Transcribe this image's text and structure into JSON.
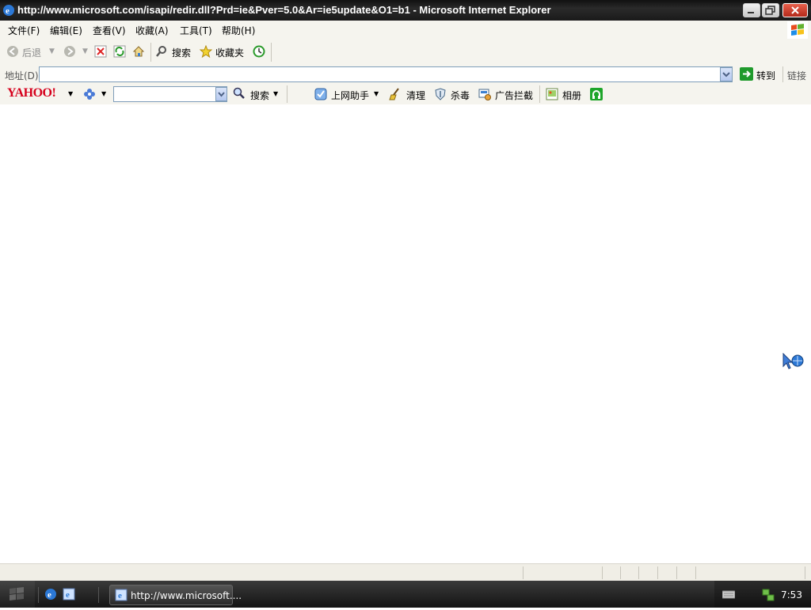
{
  "window": {
    "title": "http://www.microsoft.com/isapi/redir.dll?Prd=ie&Pver=5.0&Ar=ie5update&O1=b1 - Microsoft Internet Explorer"
  },
  "menu": {
    "items": [
      {
        "label": "文件(F)"
      },
      {
        "label": "编辑(E)"
      },
      {
        "label": "查看(V)"
      },
      {
        "label": "收藏(A)"
      },
      {
        "label": "工具(T)"
      },
      {
        "label": "帮助(H)"
      }
    ]
  },
  "toolbar": {
    "back_label": "后退",
    "search_label": "搜索",
    "favorites_label": "收藏夹"
  },
  "address": {
    "label": "地址(D)",
    "value": "",
    "go_label": "转到",
    "links_label": "链接"
  },
  "yahoo_toolbar": {
    "logo_text": "YAHOO!",
    "search_value": "",
    "search_label": "搜索",
    "assistant_label": "上网助手",
    "clean_label": "清理",
    "antivirus_label": "杀毒",
    "adblock_label": "广告拦截",
    "album_label": "相册"
  },
  "taskbar": {
    "task_label": "http://www.microsoft....",
    "clock": "7:53"
  },
  "colors": {
    "accent": "#d6001c",
    "title_bar": "#1a1a1a",
    "chrome": "#f5f4ee"
  }
}
